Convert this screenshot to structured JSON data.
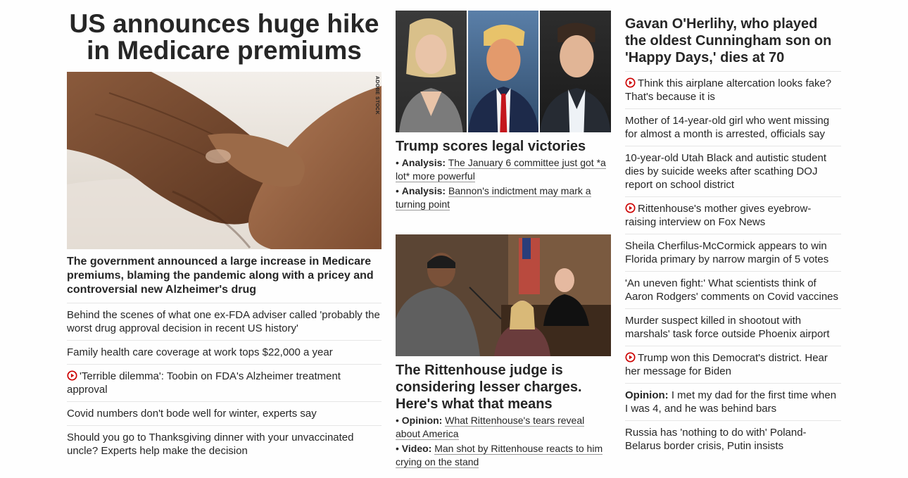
{
  "col1": {
    "headline": "US announces huge hike in Medicare premiums",
    "image_credit": "ADOBE STOCK",
    "subhead": "The government announced a large increase in Medicare premiums, blaming the pandemic along with a pricey and controversial new Alzheimer's drug",
    "items": [
      {
        "text": "Behind the scenes of what one ex-FDA adviser called 'probably the worst drug approval decision in recent US history'",
        "video": false
      },
      {
        "text": "Family health care coverage at work tops $22,000 a year",
        "video": false
      },
      {
        "text": "'Terrible dilemma': Toobin on FDA's Alzheimer treatment approval",
        "video": true
      },
      {
        "text": "Covid numbers don't bode well for winter, experts say",
        "video": false
      },
      {
        "text": "Should you go to Thanksgiving dinner with your unvaccinated uncle? Experts help make the decision",
        "video": false
      }
    ]
  },
  "col2": {
    "story1": {
      "title": "Trump scores legal victories",
      "bullets": [
        {
          "label": "Analysis:",
          "text": "The January 6 committee just got *a lot* more powerful"
        },
        {
          "label": "Analysis:",
          "text": "Bannon's indictment may mark a turning point"
        }
      ]
    },
    "story2": {
      "title": "The Rittenhouse judge is considering lesser charges. Here's what that means",
      "bullets": [
        {
          "label": "Opinion:",
          "text": "What Rittenhouse's tears reveal about America"
        },
        {
          "label": "Video:",
          "text": "Man shot by Rittenhouse reacts to him crying on the stand"
        }
      ]
    }
  },
  "col3": {
    "title": "Gavan O'Herlihy, who played the oldest Cunningham son on 'Happy Days,' dies at 70",
    "items": [
      {
        "text": "Think this airplane altercation looks fake? That's because it is",
        "video": true,
        "label": ""
      },
      {
        "text": "Mother of 14-year-old girl who went missing for almost a month is arrested, officials say",
        "video": false,
        "label": ""
      },
      {
        "text": "10-year-old Utah Black and autistic student dies by suicide weeks after scathing DOJ report on school district",
        "video": false,
        "label": ""
      },
      {
        "text": "Rittenhouse's mother gives eyebrow-raising interview on Fox News",
        "video": true,
        "label": ""
      },
      {
        "text": "Sheila Cherfilus-McCormick appears to win Florida primary by narrow margin of 5 votes",
        "video": false,
        "label": ""
      },
      {
        "text": "'An uneven fight:' What scientists think of Aaron Rodgers' comments on Covid vaccines",
        "video": false,
        "label": ""
      },
      {
        "text": "Murder suspect killed in shootout with marshals' task force outside Phoenix airport",
        "video": false,
        "label": ""
      },
      {
        "text": "Trump won this Democrat's district. Hear her message for Biden",
        "video": true,
        "label": ""
      },
      {
        "text": "I met my dad for the first time when I was 4, and he was behind bars",
        "video": false,
        "label": "Opinion:"
      },
      {
        "text": "Russia has 'nothing to do with' Poland-Belarus border crisis, Putin insists",
        "video": false,
        "label": ""
      }
    ]
  },
  "colors": {
    "video_icon": "#cc0000",
    "text": "#262626",
    "divider": "#e6e6e6"
  },
  "icons": {
    "video": "play-circle-icon"
  }
}
